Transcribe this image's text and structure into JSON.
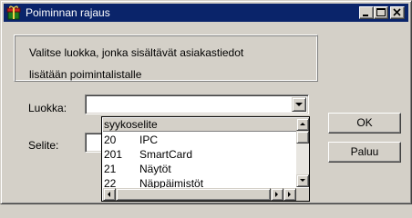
{
  "window": {
    "title": "Poiminnan rajaus",
    "buttons": {
      "minimize": "minimize-icon",
      "maximize": "maximize-icon",
      "close": "close-icon"
    }
  },
  "prompt": {
    "line1": "Valitse luokka, jonka sisältävät asiakastiedot",
    "line2": "lisätään poimintalistalle"
  },
  "form": {
    "luokka_label": "Luokka:",
    "luokka_value": "",
    "selite_label": "Selite:",
    "selite_value": ""
  },
  "buttons": {
    "ok": "OK",
    "paluu": "Paluu"
  },
  "dropdown": {
    "header": "syykoselite",
    "rows": [
      {
        "code": "20",
        "name": "IPC"
      },
      {
        "code": "201",
        "name": "SmartCard"
      },
      {
        "code": "21",
        "name": "Näytöt"
      },
      {
        "code": "22",
        "name": "Näppäimistöt"
      }
    ]
  },
  "colors": {
    "titlebar": "#0a246a",
    "face": "#d4d0c8"
  }
}
